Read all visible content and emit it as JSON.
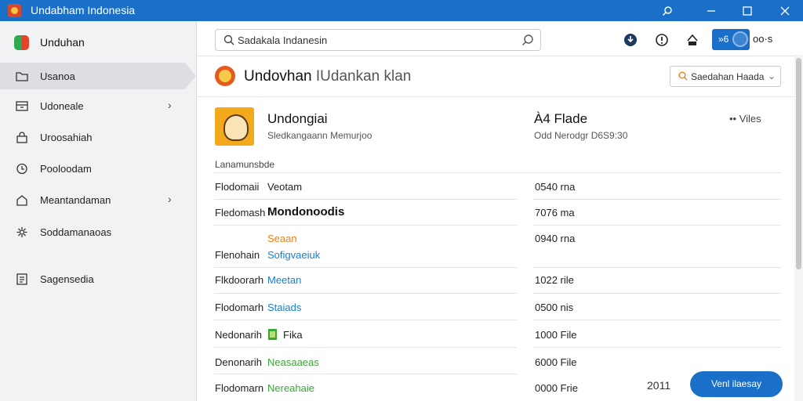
{
  "window": {
    "title": "Undabham Indonesia"
  },
  "sidebar": {
    "app_label": "Unduhan",
    "items": [
      {
        "label": "Usanoa",
        "icon": "folder-icon",
        "chevron": false,
        "active": true
      },
      {
        "label": "Udoneale",
        "icon": "archive-icon",
        "chevron": true,
        "active": false
      },
      {
        "label": "Uroosahiah",
        "icon": "lock-icon",
        "chevron": false,
        "active": false
      },
      {
        "label": "Pooloodam",
        "icon": "clock-icon",
        "chevron": false,
        "active": false
      },
      {
        "label": "Meantandaman",
        "icon": "home-icon",
        "chevron": true,
        "active": false
      },
      {
        "label": "Soddamanaoas",
        "icon": "gear-icon",
        "chevron": false,
        "active": false
      },
      {
        "label": "Sagensedia",
        "icon": "document-icon",
        "chevron": false,
        "active": false
      }
    ]
  },
  "search": {
    "text": "Sadakala Indanesin"
  },
  "toolbar": {
    "active_label": "»6",
    "more_label": "oo·s"
  },
  "header": {
    "title": "Undovhan",
    "subtitle": "IUdankan klan",
    "filter_label": "Saedahan Haada"
  },
  "card": {
    "name": "Undongiai",
    "description": "Sledkangaann Memurjoo",
    "size": "À4 Flade",
    "meta": "Odd Nerodgr D6S9:30",
    "views": "•• Viles"
  },
  "section_label": "Lanamunsbde",
  "rows": [
    {
      "name": "Flodomaii",
      "value": "Veotam",
      "value_color": "#222222",
      "size": "0540 rna"
    },
    {
      "name": "Fledomash",
      "value": "Mondonoodis",
      "value_color": "#111111",
      "size": "7076 ma"
    },
    {
      "name": "",
      "value": "Seaan",
      "value_color": "#e8801e",
      "size": "0940 rna"
    },
    {
      "name": "Flenohain",
      "value": "Sofigvaeiuk",
      "value_color": "#1a7fd0",
      "size": ""
    },
    {
      "name": "Flkdoorarh",
      "value": "Meetan",
      "value_color": "#1a7fd0",
      "size": "1022 rile"
    },
    {
      "name": "Flodomarh",
      "value": "Staiads",
      "value_color": "#1a7fd0",
      "size": "0500 nis"
    },
    {
      "name": "Nedonarih",
      "value": "Fika",
      "value_color": "#222222",
      "size": "1000 File"
    },
    {
      "name": "Denonarih",
      "value": "Neasaaeas",
      "value_color": "#3aa635",
      "size": "6000 File"
    },
    {
      "name": "Flodomarn",
      "value": "Nereahaie",
      "value_color": "#3aa635",
      "size": "0000 Frie"
    }
  ],
  "footer": {
    "year": "2011",
    "button_label": "Venl ilaesay"
  }
}
